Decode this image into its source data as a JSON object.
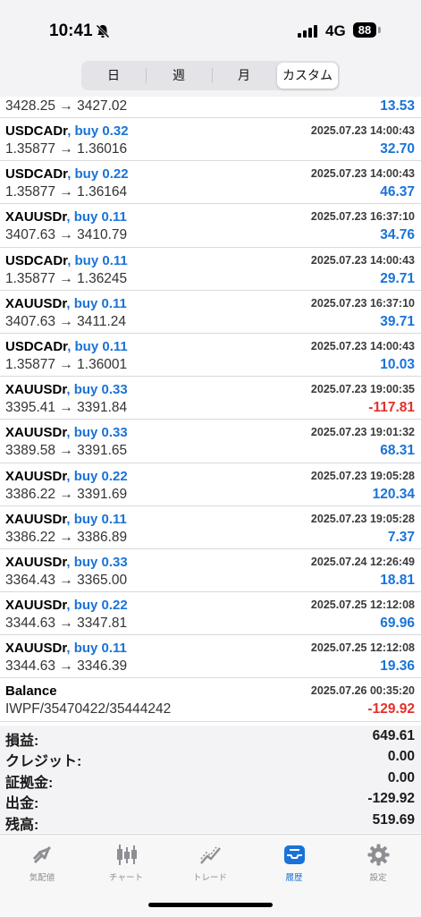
{
  "status_bar": {
    "time": "10:41",
    "network": "4G",
    "battery": "88"
  },
  "segment_tabs": [
    "日",
    "週",
    "月",
    "カスタム"
  ],
  "selected_segment": "カスタム",
  "first_deal": {
    "prices": "3428.25 → 3427.02",
    "profit": "13.53"
  },
  "deals": [
    {
      "symbol": "USDCADr",
      "type": "buy 0.32",
      "datetime": "2025.07.23 14:00:43",
      "prices": "1.35877 → 1.36016",
      "profit": "32.70",
      "negative": false
    },
    {
      "symbol": "USDCADr",
      "type": "buy 0.22",
      "datetime": "2025.07.23 14:00:43",
      "prices": "1.35877 → 1.36164",
      "profit": "46.37",
      "negative": false
    },
    {
      "symbol": "XAUUSDr",
      "type": "buy 0.11",
      "datetime": "2025.07.23 16:37:10",
      "prices": "3407.63 → 3410.79",
      "profit": "34.76",
      "negative": false
    },
    {
      "symbol": "USDCADr",
      "type": "buy 0.11",
      "datetime": "2025.07.23 14:00:43",
      "prices": "1.35877 → 1.36245",
      "profit": "29.71",
      "negative": false
    },
    {
      "symbol": "XAUUSDr",
      "type": "buy 0.11",
      "datetime": "2025.07.23 16:37:10",
      "prices": "3407.63 → 3411.24",
      "profit": "39.71",
      "negative": false
    },
    {
      "symbol": "USDCADr",
      "type": "buy 0.11",
      "datetime": "2025.07.23 14:00:43",
      "prices": "1.35877 → 1.36001",
      "profit": "10.03",
      "negative": false
    },
    {
      "symbol": "XAUUSDr",
      "type": "buy 0.33",
      "datetime": "2025.07.23 19:00:35",
      "prices": "3395.41 → 3391.84",
      "profit": "-117.81",
      "negative": true
    },
    {
      "symbol": "XAUUSDr",
      "type": "buy 0.33",
      "datetime": "2025.07.23 19:01:32",
      "prices": "3389.58 → 3391.65",
      "profit": "68.31",
      "negative": false
    },
    {
      "symbol": "XAUUSDr",
      "type": "buy 0.22",
      "datetime": "2025.07.23 19:05:28",
      "prices": "3386.22 → 3391.69",
      "profit": "120.34",
      "negative": false
    },
    {
      "symbol": "XAUUSDr",
      "type": "buy 0.11",
      "datetime": "2025.07.23 19:05:28",
      "prices": "3386.22 → 3386.89",
      "profit": "7.37",
      "negative": false
    },
    {
      "symbol": "XAUUSDr",
      "type": "buy 0.33",
      "datetime": "2025.07.24 12:26:49",
      "prices": "3364.43 → 3365.00",
      "profit": "18.81",
      "negative": false
    },
    {
      "symbol": "XAUUSDr",
      "type": "buy 0.22",
      "datetime": "2025.07.25 12:12:08",
      "prices": "3344.63 → 3347.81",
      "profit": "69.96",
      "negative": false
    },
    {
      "symbol": "XAUUSDr",
      "type": "buy 0.11",
      "datetime": "2025.07.25 12:12:08",
      "prices": "3344.63 → 3346.39",
      "profit": "19.36",
      "negative": false
    },
    {
      "symbol": "Balance",
      "type": "",
      "datetime": "2025.07.26 00:35:20",
      "prices": "IWPF/35470422/35444242",
      "profit": "-129.92",
      "negative": true
    }
  ],
  "summary": [
    {
      "label": "損益:",
      "value": "649.61"
    },
    {
      "label": "クレジット:",
      "value": "0.00"
    },
    {
      "label": "証拠金:",
      "value": "0.00"
    },
    {
      "label": "出金:",
      "value": "-129.92"
    },
    {
      "label": "残高:",
      "value": "519.69"
    }
  ],
  "tabbar": [
    {
      "label": "気配値",
      "icon": "quotes-arrows-icon"
    },
    {
      "label": "チャート",
      "icon": "candlestick-chart-icon"
    },
    {
      "label": "トレード",
      "icon": "trade-line-icon"
    },
    {
      "label": "履歴",
      "icon": "history-inbox-icon"
    },
    {
      "label": "設定",
      "icon": "settings-gear-icon"
    }
  ],
  "active_tab": "履歴",
  "colors": {
    "accent": "#1a73d8",
    "negative": "#e0322b",
    "inactive": "#8e8e93"
  }
}
